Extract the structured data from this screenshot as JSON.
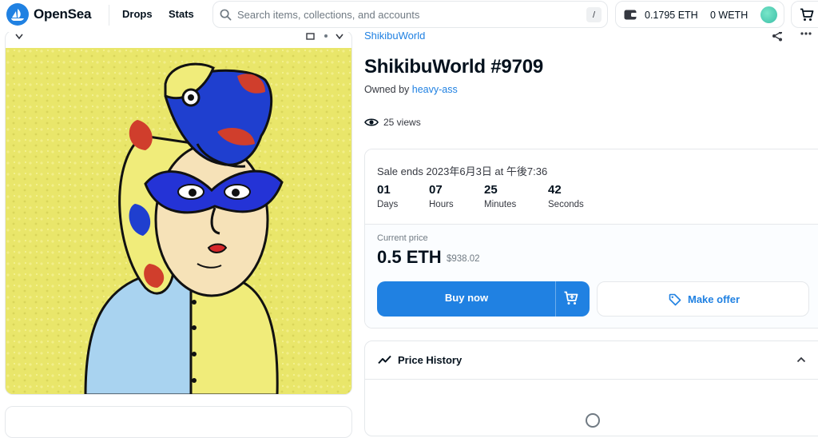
{
  "nav": {
    "brand": "OpenSea",
    "links": [
      "Drops",
      "Stats"
    ],
    "search_placeholder": "Search items, collections, and accounts",
    "search_shortcut": "/",
    "wallet_eth": "0.1795 ETH",
    "wallet_weth": "0 WETH"
  },
  "item": {
    "collection": "ShikibuWorld",
    "title": "ShikibuWorld #9709",
    "owned_by_label": "Owned by",
    "owner": "heavy-ass",
    "views": "25 views"
  },
  "sale": {
    "ends": "Sale ends 2023年6月3日 at 午後7:36",
    "countdown": [
      {
        "value": "01",
        "label": "Days"
      },
      {
        "value": "07",
        "label": "Hours"
      },
      {
        "value": "25",
        "label": "Minutes"
      },
      {
        "value": "42",
        "label": "Seconds"
      }
    ],
    "current_price_label": "Current price",
    "price": "0.5 ETH",
    "usd": "$938.02",
    "buy_label": "Buy now",
    "offer_label": "Make offer"
  },
  "price_history": {
    "title": "Price History"
  },
  "colors": {
    "accent": "#2081e2",
    "art_background": "#e9e66a"
  }
}
